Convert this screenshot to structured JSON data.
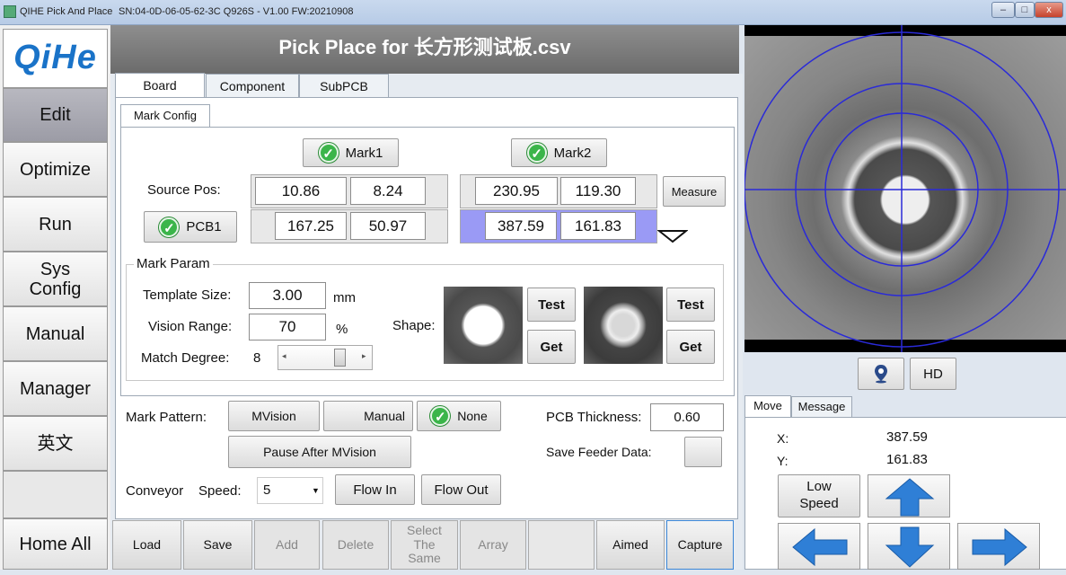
{
  "window": {
    "title": "QIHE Pick And Place",
    "info": "SN:04-0D-06-05-62-3C  Q926S - V1.00   FW:20210908",
    "controls": {
      "minimize": "–",
      "maximize": "□",
      "close": "x"
    }
  },
  "sidebar": {
    "logo": "QiHe",
    "items": [
      "Edit",
      "Optimize",
      "Run",
      "Sys Config",
      "Manual",
      "Manager",
      "英文",
      "",
      "Home All"
    ]
  },
  "header": {
    "title": "Pick Place for 长方形测试板.csv"
  },
  "tabs": [
    "Board",
    "Component",
    "SubPCB"
  ],
  "subtab": "Mark Config",
  "mark": {
    "mark1_label": "Mark1",
    "mark2_label": "Mark2",
    "source_pos_label": "Source Pos:",
    "pcb1_label": "PCB1",
    "measure_label": "Measure",
    "mark1_source": {
      "x": "10.86",
      "y": "8.24"
    },
    "mark2_source": {
      "x": "230.95",
      "y": "119.30"
    },
    "mark1_pcb": {
      "x": "167.25",
      "y": "50.97"
    },
    "mark2_pcb": {
      "x": "387.59",
      "y": "161.83"
    }
  },
  "param": {
    "title": "Mark Param",
    "template_size_label": "Template Size:",
    "template_size": "3.00",
    "template_unit": "mm",
    "vision_range_label": "Vision Range:",
    "vision_range": "70",
    "vision_unit": "%",
    "match_degree_label": "Match Degree:",
    "match_degree": "8",
    "shape_label": "Shape:",
    "test_label": "Test",
    "get_label": "Get"
  },
  "pattern": {
    "label": "Mark Pattern:",
    "mvision": "MVision",
    "manual": "Manual",
    "none": "None",
    "pause_after": "Pause After MVision",
    "pcb_thickness_label": "PCB Thickness:",
    "pcb_thickness": "0.60",
    "save_feeder_label": "Save Feeder Data:"
  },
  "conveyor": {
    "label": "Conveyor",
    "speed_label": "Speed:",
    "speed": "5",
    "flow_in": "Flow In",
    "flow_out": "Flow Out"
  },
  "toolbar": [
    "Load",
    "Save",
    "Add",
    "Delete",
    "Select The Same",
    "Array",
    "Aimed",
    "Capture"
  ],
  "camera": {
    "hd_label": "HD"
  },
  "move": {
    "tabs": [
      "Move",
      "Message"
    ],
    "x_label": "X:",
    "x": "387.59",
    "y_label": "Y:",
    "y": "161.83",
    "low_speed": "Low Speed"
  },
  "colors": {
    "highlight": "#9a9af5",
    "check": "#3bb54a",
    "arrow": "#2f7fd6"
  }
}
